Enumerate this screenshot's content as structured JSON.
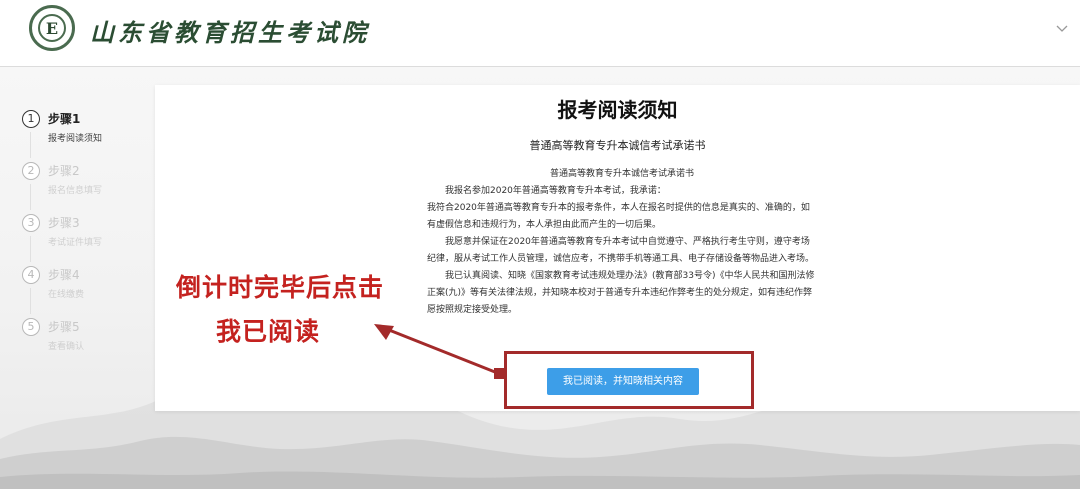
{
  "header": {
    "site_title": "山东省教育招生考试院",
    "logo_letter": "E",
    "menu_icon": "chevron-down-icon"
  },
  "steps": [
    {
      "number": "1",
      "title": "步骤1",
      "subtitle": "报考阅读须知",
      "active": true
    },
    {
      "number": "2",
      "title": "步骤2",
      "subtitle": "报名信息填写",
      "active": false
    },
    {
      "number": "3",
      "title": "步骤3",
      "subtitle": "考试证件填写",
      "active": false
    },
    {
      "number": "4",
      "title": "步骤4",
      "subtitle": "在线缴费",
      "active": false
    },
    {
      "number": "5",
      "title": "步骤5",
      "subtitle": "查看确认",
      "active": false
    }
  ],
  "card": {
    "title": "报考阅读须知",
    "subtitle": "普通高等教育专升本诚信考试承诺书",
    "pledge": {
      "heading": "普通高等教育专升本诚信考试承诺书",
      "lines": [
        "我报名参加2020年普通高等教育专升本考试，我承诺：",
        "我符合2020年普通高等教育专升本的报考条件，本人在报名时提供的信息是真实的、准确的，如有虚假信息和违规行为，本人承担由此而产生的一切后果。",
        "我愿意并保证在2020年普通高等教育专升本考试中自觉遵守、严格执行考生守则，遵守考场纪律，服从考试工作人员管理，诚信应考，不携带手机等通工具、电子存储设备等物品进入考场。",
        "我已认真阅读、知晓《国家教育考试违规处理办法》(教育部33号令)《中华人民共和国刑法修正案(九)》等有关法律法规，并知晓本校对于普通专升本违纪作弊考生的处分规定，如有违纪作弊愿按照规定接受处理。"
      ]
    },
    "confirm_button": "我已阅读，并知晓相关内容"
  },
  "annotation": {
    "line1": "倒计时完毕后点击",
    "line2": "我已阅读",
    "color": "#c4221f"
  },
  "colors": {
    "accent": "#3d9ee8",
    "brand": "#2b4d33",
    "annotation_box": "#a32a2a"
  }
}
